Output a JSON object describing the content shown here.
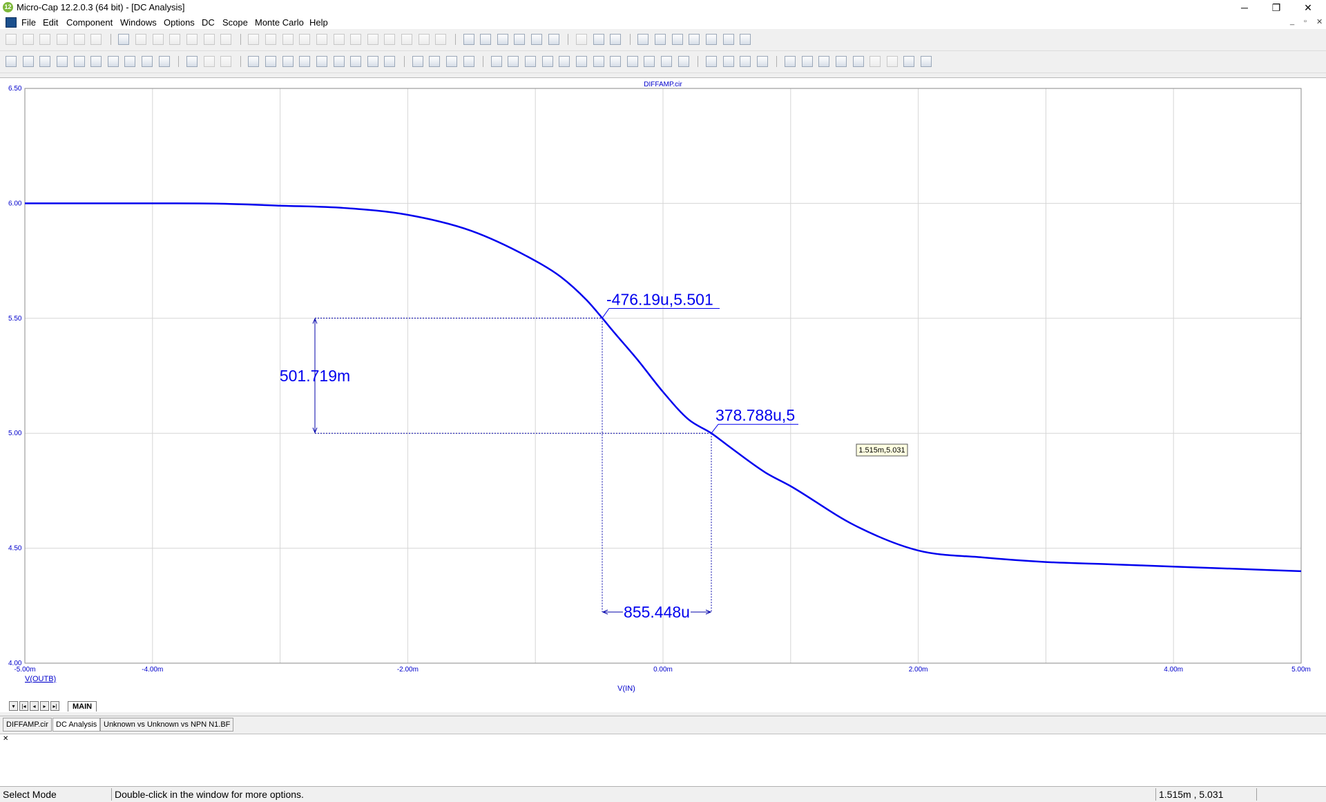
{
  "window": {
    "title": "Micro-Cap 12.2.0.3 (64 bit) - [DC Analysis]",
    "app_icon": "12",
    "buttons": [
      "─",
      "❐",
      "✕"
    ]
  },
  "menu": [
    "File",
    "Edit",
    "Component",
    "Windows",
    "Options",
    "DC",
    "Scope",
    "Monte Carlo",
    "Help"
  ],
  "mdi_buttons": [
    "_",
    "▫",
    "✕"
  ],
  "plot": {
    "title": "DIFFAMP.cir",
    "y_series_label": "V(OUTB)",
    "x_axis_label": "V(IN)",
    "x_ticks": [
      "-5.00m",
      "-4.00m",
      "-2.00m",
      "0.00m",
      "2.00m",
      "4.00m",
      "5.00m"
    ],
    "y_ticks": [
      "6.50",
      "6.00",
      "5.50",
      "5.00",
      "4.50",
      "4.00"
    ],
    "cursor_tooltip": "1.515m,5.031",
    "annotations": {
      "point1": "-476.19u,5.501",
      "point2": "378.788u,5",
      "dy": "501.719m",
      "dx": "855.448u"
    },
    "sheet_tab": "MAIN"
  },
  "chart_data": {
    "type": "line",
    "title": "DIFFAMP.cir",
    "xlabel": "V(IN)",
    "ylabel": "V(OUTB)",
    "xlim": [
      -0.005,
      0.005
    ],
    "ylim": [
      4.0,
      6.5
    ],
    "x_grid": [
      -0.005,
      -0.004,
      -0.003,
      -0.002,
      -0.001,
      0,
      0.001,
      0.002,
      0.003,
      0.004,
      0.005
    ],
    "y_grid": [
      4.0,
      4.5,
      5.0,
      5.5,
      6.0,
      6.5
    ],
    "x_tick_values": [
      -0.005,
      -0.004,
      -0.002,
      0,
      0.002,
      0.004,
      0.005
    ],
    "y_tick_values": [
      6.5,
      6.0,
      5.5,
      5.0,
      4.5,
      4.0
    ],
    "grid": true,
    "series_color": "#0000ee",
    "series": [
      {
        "name": "V(OUTB)",
        "x": [
          -0.005,
          -0.0045,
          -0.004,
          -0.0035,
          -0.003,
          -0.0025,
          -0.002,
          -0.0015,
          -0.001,
          -0.0008,
          -0.0006,
          -0.000476,
          -0.0004,
          -0.0002,
          0,
          0.0002,
          0.000379,
          0.0005,
          0.0008,
          0.001,
          0.0015,
          0.002,
          0.0025,
          0.003,
          0.0035,
          0.004,
          0.0045,
          0.005
        ],
        "y": [
          6.0,
          6.0,
          6.0,
          5.999,
          5.99,
          5.98,
          5.95,
          5.88,
          5.75,
          5.68,
          5.58,
          5.501,
          5.45,
          5.32,
          5.18,
          5.06,
          5.0,
          4.95,
          4.83,
          4.77,
          4.6,
          4.49,
          4.46,
          4.44,
          4.43,
          4.42,
          4.41,
          4.4
        ]
      }
    ],
    "markers": [
      {
        "label": "-476.19u,5.501",
        "x": -0.00047619,
        "y": 5.501
      },
      {
        "label": "378.788u,5",
        "x": 0.000378788,
        "y": 5.0
      }
    ],
    "dimensions": [
      {
        "label": "501.719m",
        "axis": "y",
        "from": 5.0,
        "to": 5.501
      },
      {
        "label": "855.448u",
        "axis": "x",
        "from": -0.00047619,
        "to": 0.000378788
      }
    ]
  },
  "doc_tabs": [
    "DIFFAMP.cir",
    "DC Analysis",
    "Unknown vs Unknown vs NPN N1.BF"
  ],
  "status": {
    "mode": "Select Mode",
    "hint": "Double-click in the window for more options.",
    "coords": "1.515m , 5.031"
  }
}
